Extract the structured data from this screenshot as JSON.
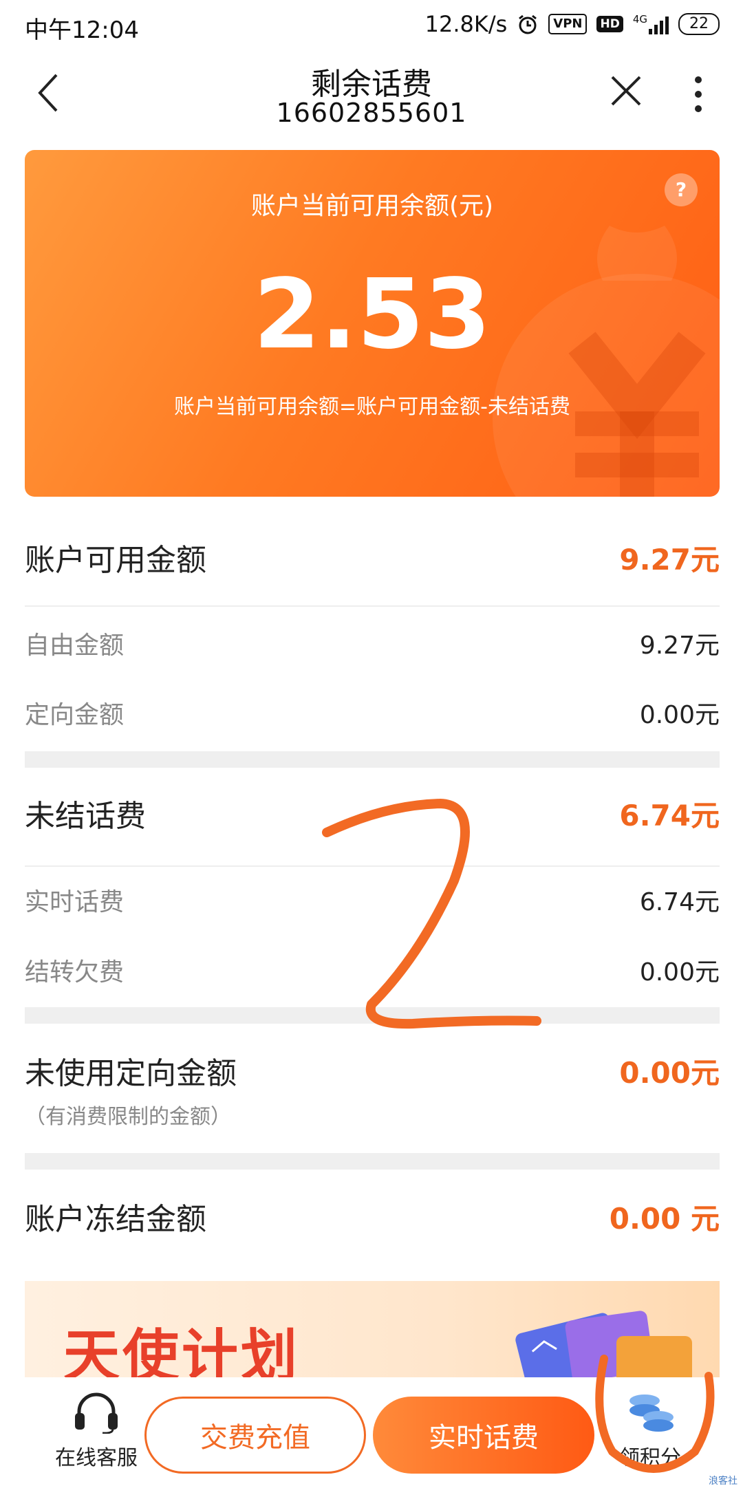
{
  "status_bar": {
    "time": "中午12:04",
    "speed": "12.8K/s",
    "vpn": "VPN",
    "hd": "HD",
    "network": "4G",
    "battery": "22"
  },
  "header": {
    "title": "剩余话费",
    "phone": "16602855601"
  },
  "balance_card": {
    "label": "账户当前可用余额(元)",
    "amount": "2.53",
    "formula": "账户当前可用余额=账户可用金额-未结话费",
    "help": "?"
  },
  "available": {
    "label": "账户可用金额",
    "value": "9.27元",
    "items": [
      {
        "label": "自由金额",
        "value": "9.27元"
      },
      {
        "label": "定向金额",
        "value": "0.00元"
      }
    ]
  },
  "unsettled": {
    "label": "未结话费",
    "value": "6.74元",
    "items": [
      {
        "label": "实时话费",
        "value": "6.74元"
      },
      {
        "label": "结转欠费",
        "value": "0.00元"
      }
    ]
  },
  "unused_directed": {
    "label": "未使用定向金额",
    "note": "（有消费限制的金额）",
    "value": "0.00元"
  },
  "frozen": {
    "label": "账户冻结金额",
    "value": "0.00 元"
  },
  "banner": {
    "text": "天使计划"
  },
  "bottom_bar": {
    "service_label": "在线客服",
    "pay_label": "交费充值",
    "realtime_label": "实时话费",
    "points_label": "领积分"
  },
  "watermark": "浪客社区",
  "colors": {
    "accent": "#f0661e",
    "card_start": "#ff9a3d",
    "card_end": "#ff5e14"
  }
}
